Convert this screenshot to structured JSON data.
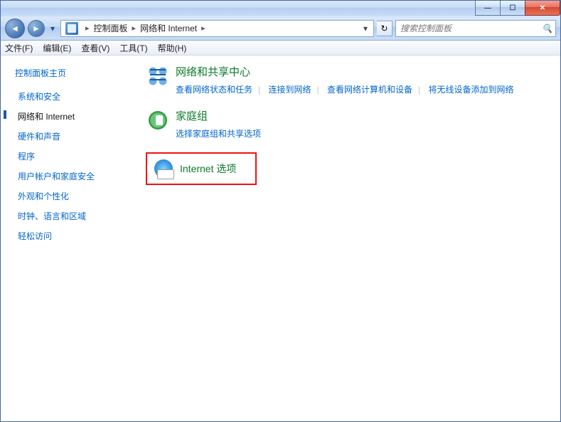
{
  "titlebar": {
    "minimize": "—",
    "maximize": "☐",
    "close": "✕"
  },
  "nav": {
    "back": "◄",
    "forward": "►",
    "dropdown": "▾",
    "refresh": "↻"
  },
  "breadcrumb": {
    "sep": "▸",
    "root_label": "",
    "items": [
      "控制面板",
      "网络和 Internet"
    ]
  },
  "search": {
    "placeholder": "搜索控制面板"
  },
  "menus": [
    "文件(F)",
    "编辑(E)",
    "查看(V)",
    "工具(T)",
    "帮助(H)"
  ],
  "sidebar": {
    "home": "控制面板主页",
    "items": [
      "系统和安全",
      "网络和 Internet",
      "硬件和声音",
      "程序",
      "用户帐户和家庭安全",
      "外观和个性化",
      "时钟、语言和区域",
      "轻松访问"
    ],
    "active_index": 1
  },
  "categories": [
    {
      "title": "网络和共享中心",
      "links": [
        "查看网络状态和任务",
        "连接到网络",
        "查看网络计算机和设备",
        "将无线设备添加到网络"
      ]
    },
    {
      "title": "家庭组",
      "links": [
        "选择家庭组和共享选项"
      ]
    },
    {
      "title": "Internet 选项",
      "links": []
    }
  ],
  "internet_checkmark": "✓"
}
